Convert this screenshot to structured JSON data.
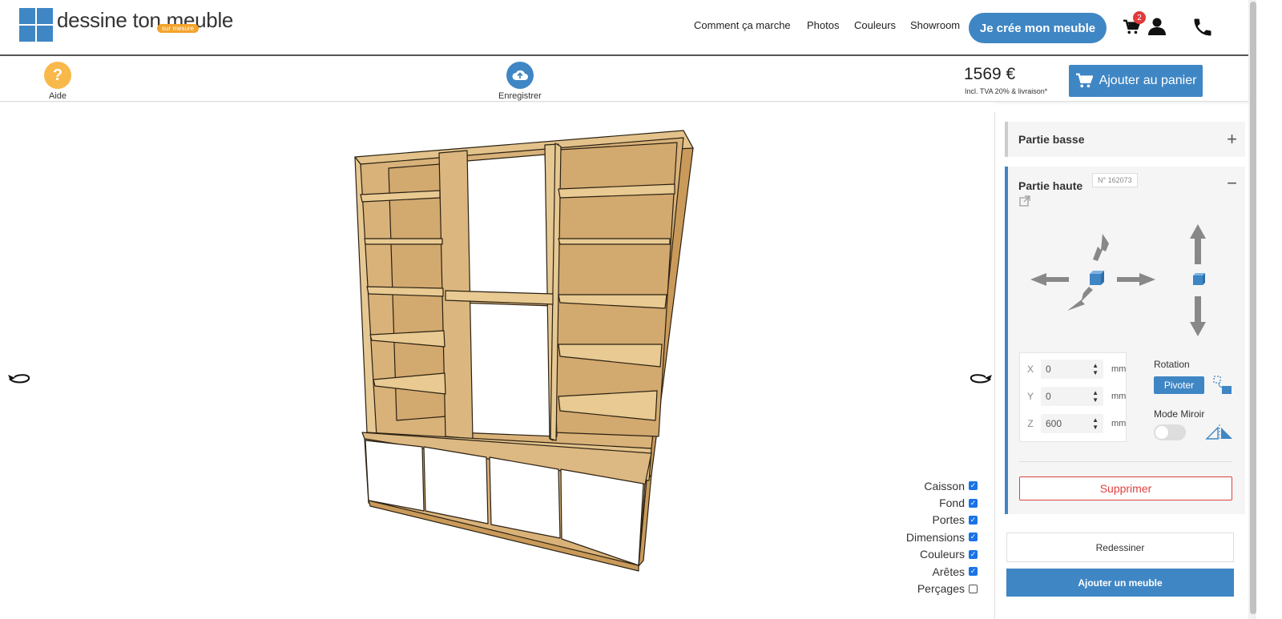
{
  "brand": {
    "name": "dessine ton meuble",
    "tagline": "sur mesure"
  },
  "nav": {
    "items": [
      "Comment ça marche",
      "Photos",
      "Couleurs",
      "Showroom"
    ],
    "cta": "Je crée mon meuble",
    "cart_count": "2"
  },
  "toolbar": {
    "help_label": "Aide",
    "save_label": "Enregistrer",
    "price": "1569 €",
    "price_note": "Incl. TVA 20% & livraison*",
    "add_to_cart": "Ajouter au panier"
  },
  "view_options": [
    {
      "label": "Caisson",
      "checked": true
    },
    {
      "label": "Fond",
      "checked": true
    },
    {
      "label": "Portes",
      "checked": true
    },
    {
      "label": "Dimensions",
      "checked": true
    },
    {
      "label": "Couleurs",
      "checked": true
    },
    {
      "label": "Arêtes",
      "checked": true
    },
    {
      "label": "Perçages",
      "checked": false
    }
  ],
  "panel": {
    "section_low": "Partie basse",
    "section_high": "Partie haute",
    "section_high_number": "N° 162073",
    "coords": [
      {
        "axis": "X",
        "value": "0",
        "unit": "mm"
      },
      {
        "axis": "Y",
        "value": "0",
        "unit": "mm"
      },
      {
        "axis": "Z",
        "value": "600",
        "unit": "mm"
      }
    ],
    "rotation_label": "Rotation",
    "rotate_button": "Pivoter",
    "mirror_label": "Mode Miroir",
    "delete_button": "Supprimer",
    "redraw_button": "Redessiner",
    "add_furniture_button": "Ajouter un meuble"
  },
  "colors": {
    "accent": "#3f86c4",
    "wood": "#d8b57a",
    "help": "#f9b84a"
  }
}
